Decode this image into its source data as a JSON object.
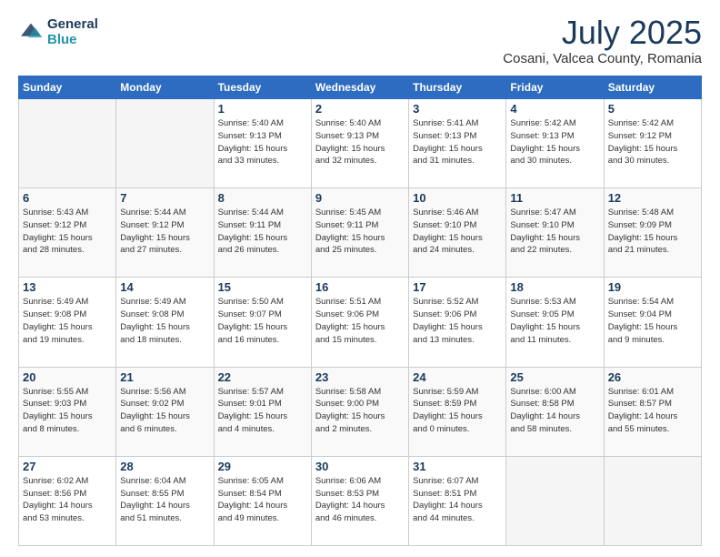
{
  "header": {
    "logo_line1": "General",
    "logo_line2": "Blue",
    "month_title": "July 2025",
    "location": "Cosani, Valcea County, Romania"
  },
  "days_of_week": [
    "Sunday",
    "Monday",
    "Tuesday",
    "Wednesday",
    "Thursday",
    "Friday",
    "Saturday"
  ],
  "weeks": [
    [
      {
        "day": "",
        "info": ""
      },
      {
        "day": "",
        "info": ""
      },
      {
        "day": "1",
        "info": "Sunrise: 5:40 AM\nSunset: 9:13 PM\nDaylight: 15 hours\nand 33 minutes."
      },
      {
        "day": "2",
        "info": "Sunrise: 5:40 AM\nSunset: 9:13 PM\nDaylight: 15 hours\nand 32 minutes."
      },
      {
        "day": "3",
        "info": "Sunrise: 5:41 AM\nSunset: 9:13 PM\nDaylight: 15 hours\nand 31 minutes."
      },
      {
        "day": "4",
        "info": "Sunrise: 5:42 AM\nSunset: 9:13 PM\nDaylight: 15 hours\nand 30 minutes."
      },
      {
        "day": "5",
        "info": "Sunrise: 5:42 AM\nSunset: 9:12 PM\nDaylight: 15 hours\nand 30 minutes."
      }
    ],
    [
      {
        "day": "6",
        "info": "Sunrise: 5:43 AM\nSunset: 9:12 PM\nDaylight: 15 hours\nand 28 minutes."
      },
      {
        "day": "7",
        "info": "Sunrise: 5:44 AM\nSunset: 9:12 PM\nDaylight: 15 hours\nand 27 minutes."
      },
      {
        "day": "8",
        "info": "Sunrise: 5:44 AM\nSunset: 9:11 PM\nDaylight: 15 hours\nand 26 minutes."
      },
      {
        "day": "9",
        "info": "Sunrise: 5:45 AM\nSunset: 9:11 PM\nDaylight: 15 hours\nand 25 minutes."
      },
      {
        "day": "10",
        "info": "Sunrise: 5:46 AM\nSunset: 9:10 PM\nDaylight: 15 hours\nand 24 minutes."
      },
      {
        "day": "11",
        "info": "Sunrise: 5:47 AM\nSunset: 9:10 PM\nDaylight: 15 hours\nand 22 minutes."
      },
      {
        "day": "12",
        "info": "Sunrise: 5:48 AM\nSunset: 9:09 PM\nDaylight: 15 hours\nand 21 minutes."
      }
    ],
    [
      {
        "day": "13",
        "info": "Sunrise: 5:49 AM\nSunset: 9:08 PM\nDaylight: 15 hours\nand 19 minutes."
      },
      {
        "day": "14",
        "info": "Sunrise: 5:49 AM\nSunset: 9:08 PM\nDaylight: 15 hours\nand 18 minutes."
      },
      {
        "day": "15",
        "info": "Sunrise: 5:50 AM\nSunset: 9:07 PM\nDaylight: 15 hours\nand 16 minutes."
      },
      {
        "day": "16",
        "info": "Sunrise: 5:51 AM\nSunset: 9:06 PM\nDaylight: 15 hours\nand 15 minutes."
      },
      {
        "day": "17",
        "info": "Sunrise: 5:52 AM\nSunset: 9:06 PM\nDaylight: 15 hours\nand 13 minutes."
      },
      {
        "day": "18",
        "info": "Sunrise: 5:53 AM\nSunset: 9:05 PM\nDaylight: 15 hours\nand 11 minutes."
      },
      {
        "day": "19",
        "info": "Sunrise: 5:54 AM\nSunset: 9:04 PM\nDaylight: 15 hours\nand 9 minutes."
      }
    ],
    [
      {
        "day": "20",
        "info": "Sunrise: 5:55 AM\nSunset: 9:03 PM\nDaylight: 15 hours\nand 8 minutes."
      },
      {
        "day": "21",
        "info": "Sunrise: 5:56 AM\nSunset: 9:02 PM\nDaylight: 15 hours\nand 6 minutes."
      },
      {
        "day": "22",
        "info": "Sunrise: 5:57 AM\nSunset: 9:01 PM\nDaylight: 15 hours\nand 4 minutes."
      },
      {
        "day": "23",
        "info": "Sunrise: 5:58 AM\nSunset: 9:00 PM\nDaylight: 15 hours\nand 2 minutes."
      },
      {
        "day": "24",
        "info": "Sunrise: 5:59 AM\nSunset: 8:59 PM\nDaylight: 15 hours\nand 0 minutes."
      },
      {
        "day": "25",
        "info": "Sunrise: 6:00 AM\nSunset: 8:58 PM\nDaylight: 14 hours\nand 58 minutes."
      },
      {
        "day": "26",
        "info": "Sunrise: 6:01 AM\nSunset: 8:57 PM\nDaylight: 14 hours\nand 55 minutes."
      }
    ],
    [
      {
        "day": "27",
        "info": "Sunrise: 6:02 AM\nSunset: 8:56 PM\nDaylight: 14 hours\nand 53 minutes."
      },
      {
        "day": "28",
        "info": "Sunrise: 6:04 AM\nSunset: 8:55 PM\nDaylight: 14 hours\nand 51 minutes."
      },
      {
        "day": "29",
        "info": "Sunrise: 6:05 AM\nSunset: 8:54 PM\nDaylight: 14 hours\nand 49 minutes."
      },
      {
        "day": "30",
        "info": "Sunrise: 6:06 AM\nSunset: 8:53 PM\nDaylight: 14 hours\nand 46 minutes."
      },
      {
        "day": "31",
        "info": "Sunrise: 6:07 AM\nSunset: 8:51 PM\nDaylight: 14 hours\nand 44 minutes."
      },
      {
        "day": "",
        "info": ""
      },
      {
        "day": "",
        "info": ""
      }
    ]
  ]
}
